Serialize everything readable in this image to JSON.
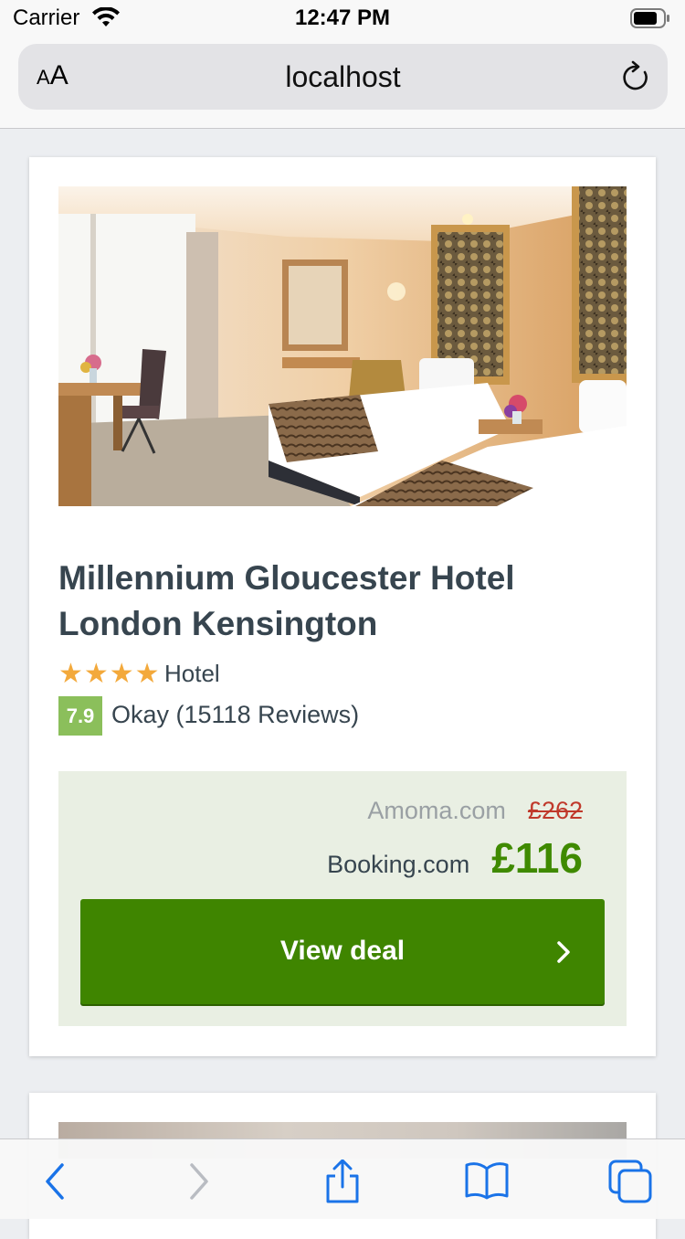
{
  "status_bar": {
    "carrier": "Carrier",
    "time": "12:47 PM"
  },
  "browser": {
    "text_size_label": "AA",
    "url": "localhost"
  },
  "hotel": {
    "name": "Millennium Gloucester Hotel London Kensington",
    "stars_display": "★★★★",
    "star_count": 4,
    "type": "Hotel",
    "score": "7.9",
    "review_summary": "Okay (15118 Reviews)"
  },
  "deal": {
    "alt_provider": "Amoma.com",
    "alt_price": "£262",
    "main_provider": "Booking.com",
    "main_price": "£116",
    "button_label": "View deal"
  },
  "colors": {
    "title": "#37454f",
    "star": "#f3a93b",
    "score_badge": "#8bbf5b",
    "deal_background": "#e9efe3",
    "button": "#3f8500",
    "price_green": "#3f8a00",
    "strike_price": "#c0392b",
    "ios_blue": "#1a73e8"
  },
  "toolbar_icons": [
    "back-icon",
    "forward-icon",
    "share-icon",
    "bookmarks-icon",
    "tabs-icon"
  ]
}
